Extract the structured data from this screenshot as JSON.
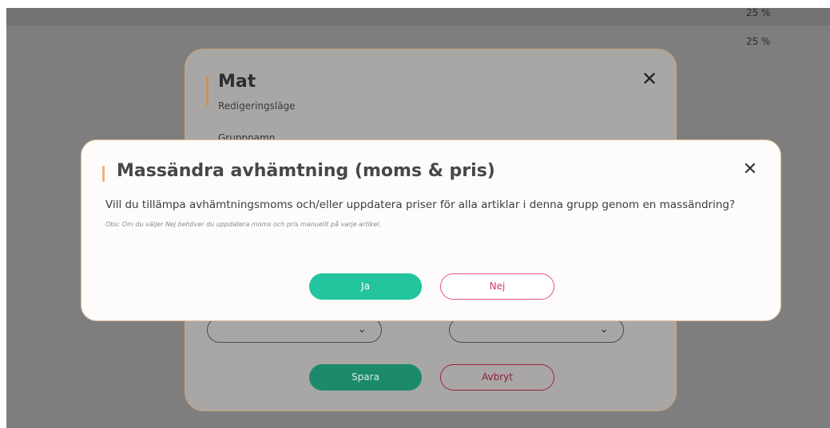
{
  "background": {
    "vat_values": [
      "25 %",
      "25 %"
    ]
  },
  "edit_dialog": {
    "title": "Mat",
    "subtitle": "Redigeringsläge",
    "field_label": "Gruppnamn",
    "close_icon": "close-icon",
    "save_label": "Spara",
    "cancel_label": "Avbryt"
  },
  "confirm_modal": {
    "title": "Massändra avhämtning (moms & pris)",
    "question": "Vill du tillämpa avhämtningsmoms och/eller uppdatera priser för alla artiklar i denna grupp genom en massändring?",
    "note": "Obs: Om du väljer Nej behöver du uppdatera moms och pris manuellt på varje artikel.",
    "yes_label": "Ja",
    "no_label": "Nej",
    "close_icon": "close-icon"
  },
  "colors": {
    "accent_orange": "#efb27e",
    "primary_green": "#22c59e",
    "danger_pink": "#e2557e",
    "overlay_gray": "#7e7e7e"
  }
}
